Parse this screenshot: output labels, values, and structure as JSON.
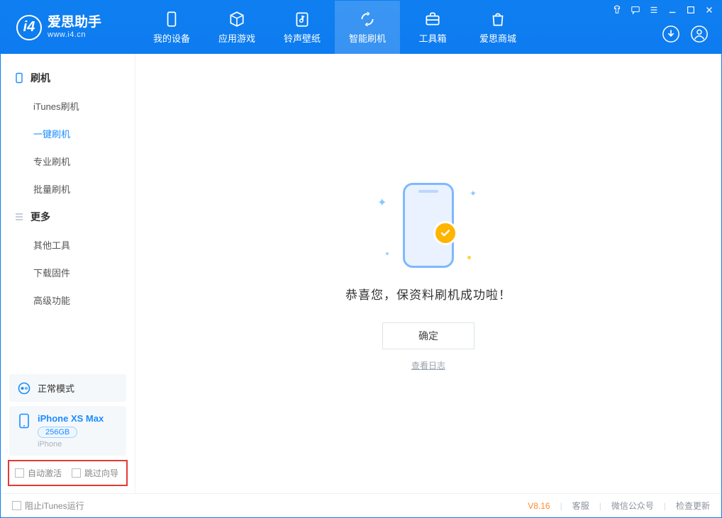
{
  "app": {
    "name": "爱思助手",
    "site": "www.i4.cn"
  },
  "header_tabs": [
    {
      "label": "我的设备",
      "icon": "device"
    },
    {
      "label": "应用游戏",
      "icon": "cube"
    },
    {
      "label": "铃声壁纸",
      "icon": "note"
    },
    {
      "label": "智能刷机",
      "icon": "refresh",
      "active": true
    },
    {
      "label": "工具箱",
      "icon": "toolbox"
    },
    {
      "label": "爱思商城",
      "icon": "bag"
    }
  ],
  "sidebar": {
    "section1_title": "刷机",
    "section2_title": "更多",
    "items1": [
      {
        "label": "iTunes刷机"
      },
      {
        "label": "一键刷机",
        "active": true
      },
      {
        "label": "专业刷机"
      },
      {
        "label": "批量刷机"
      }
    ],
    "items2": [
      {
        "label": "其他工具"
      },
      {
        "label": "下载固件"
      },
      {
        "label": "高级功能"
      }
    ],
    "mode_label": "正常模式",
    "device": {
      "name": "iPhone XS Max",
      "storage": "256GB",
      "type": "iPhone"
    },
    "check_auto_activate": "自动激活",
    "check_skip_guide": "跳过向导"
  },
  "main": {
    "success_message": "恭喜您，保资料刷机成功啦！",
    "ok_button": "确定",
    "view_log": "查看日志"
  },
  "footer": {
    "block_itunes": "阻止iTunes运行",
    "version": "V8.16",
    "links": [
      "客服",
      "微信公众号",
      "检查更新"
    ]
  }
}
